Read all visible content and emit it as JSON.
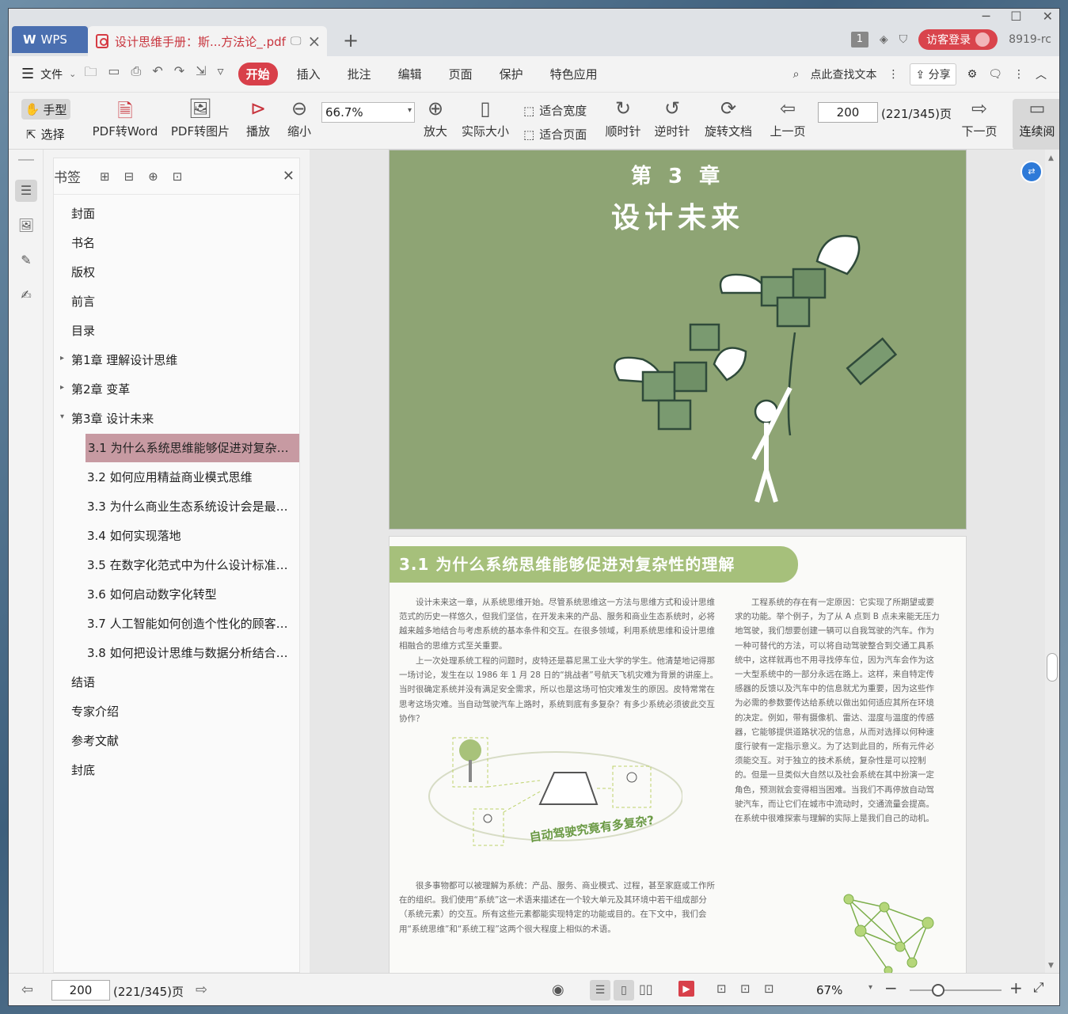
{
  "titlebar": {
    "app_tab": "WPS",
    "doc_tab": "设计思维手册：斯...方法论_.pdf",
    "tab_count": "1",
    "login": "访客登录",
    "user": "8919-rc"
  },
  "menu": {
    "file": "文件",
    "tabs": [
      "开始",
      "插入",
      "批注",
      "编辑",
      "页面",
      "保护",
      "特色应用"
    ],
    "search": "点此查找文本",
    "share": "分享"
  },
  "ribbon": {
    "hand": "手型",
    "select": "选择",
    "pdf_to_word": "PDF转Word",
    "pdf_to_image": "PDF转图片",
    "play": "播放",
    "zoom_out": "缩小",
    "zoom_value": "66.7%",
    "zoom_in": "放大",
    "actual_size": "实际大小",
    "fit_width": "适合宽度",
    "fit_page": "适合页面",
    "rotate_cw": "顺时针",
    "rotate_ccw": "逆时针",
    "rotate_doc": "旋转文档",
    "prev_page": "上一页",
    "page_input": "200",
    "page_total": "(221/345)页",
    "next_page": "下一页",
    "continuous": "连续阅"
  },
  "bookmarks": {
    "title": "书签",
    "items": [
      {
        "label": "封面"
      },
      {
        "label": "书名"
      },
      {
        "label": "版权"
      },
      {
        "label": "前言"
      },
      {
        "label": "目录"
      },
      {
        "label": "第1章 理解设计思维"
      },
      {
        "label": "第2章 变革"
      },
      {
        "label": "第3章 设计未来"
      },
      {
        "label": "3.1 为什么系统思维能够促进对复杂性..."
      },
      {
        "label": "3.2 如何应用精益商业模式思维"
      },
      {
        "label": "3.3 为什么商业生态系统设计会是最终..."
      },
      {
        "label": "3.4 如何实现落地"
      },
      {
        "label": "3.5 在数字化范式中为什么设计标准会..."
      },
      {
        "label": "3.6 如何启动数字化转型"
      },
      {
        "label": "3.7 人工智能如何创造个性化的顾客体验"
      },
      {
        "label": "3.8 如何把设计思维与数据分析结合起..."
      },
      {
        "label": "结语"
      },
      {
        "label": "专家介绍"
      },
      {
        "label": "参考文献"
      },
      {
        "label": "封底"
      }
    ]
  },
  "document": {
    "chapter_number": "第 3 章",
    "chapter_title": "设计未来",
    "section_title": "3.1   为什么系统思维能够促进对复杂性的理解",
    "left_para1": "设计未来这一章，从系统思维开始。尽管系统思维这一方法与思维方式和设计思维范式的历史一样悠久，但我们坚信，在开发未来的产品、服务和商业生态系统时，必将越来越多地结合与考虑系统的基本条件和交互。在很多领域，利用系统思维和设计思维相融合的思维方式至关重要。",
    "left_para2": "上一次处理系统工程的问题时，皮特还是慕尼黑工业大学的学生。他清楚地记得那一场讨论，发生在以 1986 年 1 月 28 日的“挑战者”号航天飞机灾难为背景的讲座上。当时很确定系统并没有满足安全需求，所以也是这场可怕灾难发生的原因。皮特常常在思考这场灾难。当自动驾驶汽车上路时，系统到底有多复杂？有多少系统必须彼此交互协作？",
    "figure_caption": "自动驾驶究竟有多复杂?",
    "left_para3": "很多事物都可以被理解为系统：产品、服务、商业模式、过程，甚至家庭或工作所在的组织。我们使用“系统”这一术语来描述在一个较大单元及其环境中若干组成部分（系统元素）的交互。所有这些元素都能实现特定的功能或目的。在下文中，我们会用“系统思维”和“系统工程”这两个很大程度上相似的术语。",
    "right_para": "工程系统的存在有一定原因：它实现了所期望或要求的功能。举个例子，为了从 A 点到 B 点未来能无压力地驾驶，我们想要创建一辆可以自我驾驶的汽车。作为一种可替代的方法，可以将自动驾驶整合到交通工具系统中，这样就再也不用寻找停车位，因为汽车会作为这一大型系统中的一部分永远在路上。这样，来自特定传感器的反馈以及汽车中的信息就尤为重要，因为这些作为必需的参数要传达给系统以做出如何适应其所在环境的决定。例如，带有摄像机、雷达、湿度与温度的传感器，它能够提供道路状况的信息，从而对选择以何种速度行驶有一定指示意义。为了达到此目的，所有元件必须能交互。对于独立的技术系统，复杂性是可以控制的。但是一旦类似大自然以及社会系统在其中扮演一定角色，预测就会变得相当困难。当我们不再停放自动驾驶汽车，而让它们在城市中流动时，交通流量会提高。在系统中很难探索与理解的实际上是我们自己的动机。"
  },
  "statusbar": {
    "page_input": "200",
    "page_total": "(221/345)页",
    "zoom": "67%"
  },
  "colors": {
    "accent": "#d8404a",
    "cover_green": "#8ea474",
    "section_green": "#a6c07b",
    "selected_bookmark": "#c79aa2"
  }
}
